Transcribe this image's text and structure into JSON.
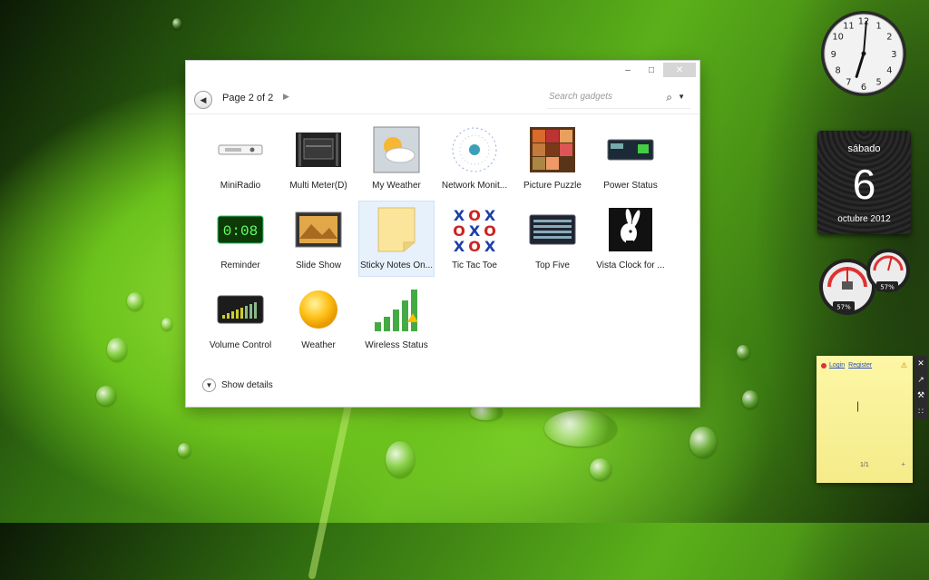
{
  "window": {
    "minimize_icon": "minimize-icon",
    "maximize_icon": "maximize-icon",
    "close_icon": "close-icon",
    "page_label": "Page 2 of 2",
    "search_placeholder": "Search gadgets"
  },
  "gadgets": [
    {
      "label": "MiniRadio",
      "icon": "radio-icon"
    },
    {
      "label": "Multi Meter(D)",
      "icon": "multimeter-icon"
    },
    {
      "label": "My Weather",
      "icon": "weather-icon"
    },
    {
      "label": "Network Monit...",
      "icon": "network-icon"
    },
    {
      "label": "Picture Puzzle",
      "icon": "puzzle-icon"
    },
    {
      "label": "Power Status",
      "icon": "battery-icon"
    },
    {
      "label": "Reminder",
      "icon": "reminder-icon"
    },
    {
      "label": "Slide Show",
      "icon": "slideshow-icon"
    },
    {
      "label": "Sticky Notes On...",
      "icon": "sticky-note-icon"
    },
    {
      "label": "Tic Tac Toe",
      "icon": "tictactoe-icon"
    },
    {
      "label": "Top Five",
      "icon": "topfive-icon"
    },
    {
      "label": "Vista Clock for ...",
      "icon": "bunny-clock-icon"
    },
    {
      "label": "Volume Control",
      "icon": "volume-icon"
    },
    {
      "label": "Weather",
      "icon": "sun-icon"
    },
    {
      "label": "Wireless Status",
      "icon": "signal-bars-icon"
    }
  ],
  "selected_gadget": "Sticky Notes On...",
  "details": {
    "label": "Show details"
  },
  "reminder_display": "0:08",
  "clock": {
    "numbers": [
      "12",
      "1",
      "2",
      "3",
      "4",
      "5",
      "6",
      "7",
      "8",
      "9",
      "10",
      "11"
    ]
  },
  "calendar": {
    "day_name": "sábado",
    "day_number": "6",
    "month_year": "octubre 2012"
  },
  "cpu_meter": {
    "cpu": "57%",
    "ram": "57%"
  },
  "notes": {
    "login": "Login",
    "register": "Register",
    "page": "1/1"
  }
}
